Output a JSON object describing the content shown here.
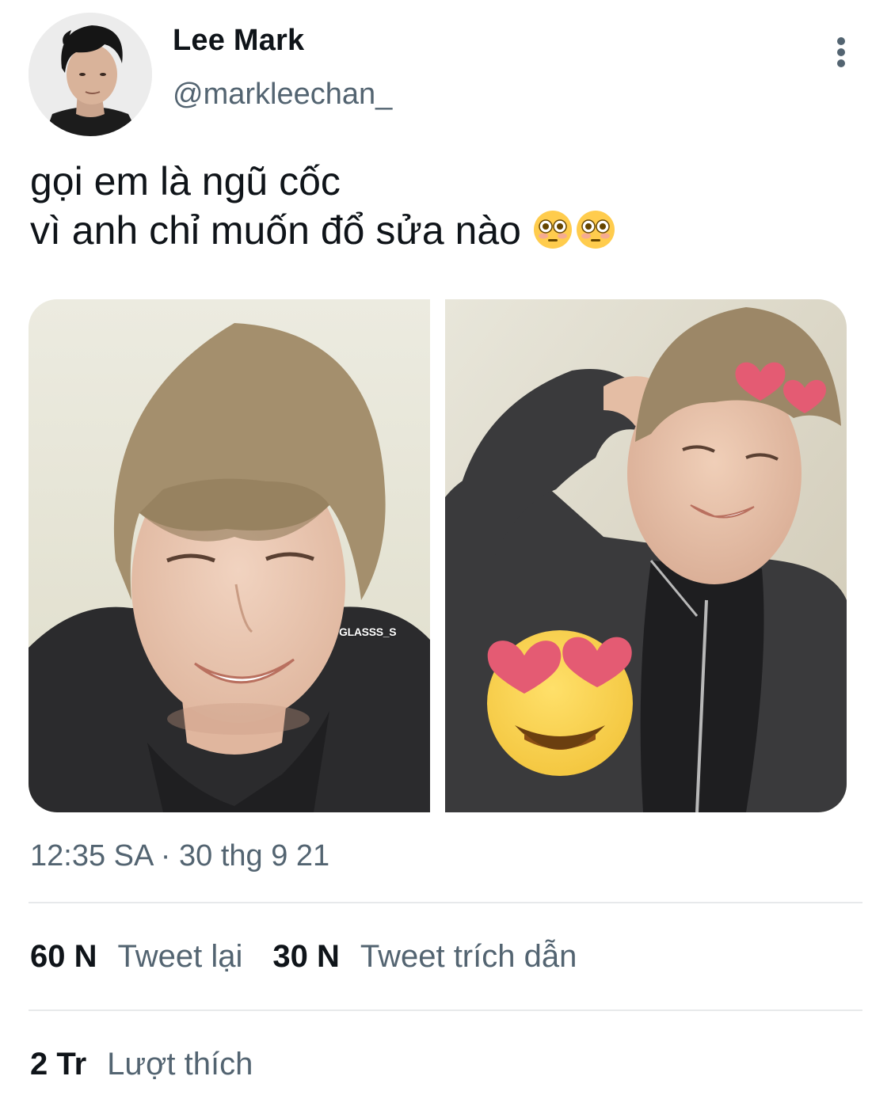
{
  "author": {
    "display_name": "Lee Mark",
    "handle": "@markleechan_",
    "avatar_icon": "profile-photo"
  },
  "header": {
    "more_icon": "more-vertical-icon"
  },
  "tweet": {
    "text_line_1": "gọi em là ngũ cốc",
    "text_line_2": "vì anh chỉ muốn đổ sửa nào",
    "trailing_emojis": [
      "flushed-face-emoji",
      "flushed-face-emoji"
    ]
  },
  "media": {
    "photos": [
      {
        "subject": "smiling person with light brown hair in dark hoodie",
        "watermark": "GLASSS_S"
      },
      {
        "subject": "person touching face with heart stickers and heart-eyes emoji sticker"
      }
    ]
  },
  "meta": {
    "timestamp": "12:35 SA · 30 thg 9 21"
  },
  "stats": {
    "retweets_count": "60 N",
    "retweets_label": "Tweet lại",
    "quotes_count": "30 N",
    "quotes_label": "Tweet trích dẫn",
    "likes_count": "2 Tr",
    "likes_label": "Lượt thích"
  },
  "colors": {
    "text_primary": "#0f1419",
    "text_secondary": "#536471",
    "divider": "#e7e9eb",
    "background": "#ffffff"
  }
}
